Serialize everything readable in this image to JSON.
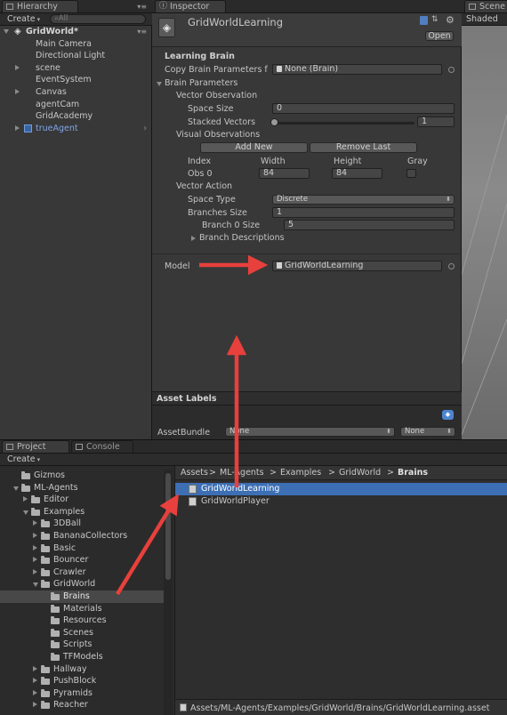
{
  "hierarchy": {
    "tab_label": "Hierarchy",
    "create_label": "Create",
    "search_placeholder": "All",
    "scene_name": "GridWorld*",
    "items": [
      {
        "label": "Main Camera",
        "expandable": false
      },
      {
        "label": "Directional Light",
        "expandable": false
      },
      {
        "label": "scene",
        "expandable": true
      },
      {
        "label": "EventSystem",
        "expandable": false
      },
      {
        "label": "Canvas",
        "expandable": true
      },
      {
        "label": "agentCam",
        "expandable": false
      },
      {
        "label": "GridAcademy",
        "expandable": false
      },
      {
        "label": "trueAgent",
        "expandable": true
      }
    ]
  },
  "inspector": {
    "tab_label": "Inspector",
    "object_name": "GridWorldLearning",
    "open_label": "Open",
    "section_title": "Learning Brain",
    "copy_brain_label": "Copy Brain Parameters f",
    "copy_brain_value": "None (Brain)",
    "brain_params_label": "Brain Parameters",
    "vector_observation_label": "Vector Observation",
    "space_size_label": "Space Size",
    "space_size_value": "0",
    "stacked_vectors_label": "Stacked Vectors",
    "stacked_vectors_value": "1",
    "visual_observations_label": "Visual Observations",
    "add_new_label": "Add New",
    "remove_last_label": "Remove Last",
    "col_index": "Index",
    "col_width": "Width",
    "col_height": "Height",
    "col_gray": "Gray",
    "obs0_label": "Obs 0",
    "obs0_width": "84",
    "obs0_height": "84",
    "vector_action_label": "Vector Action",
    "space_type_label": "Space Type",
    "space_type_value": "Discrete",
    "branches_size_label": "Branches Size",
    "branches_size_value": "1",
    "branch0_size_label": "Branch 0 Size",
    "branch0_size_value": "5",
    "branch_descriptions_label": "Branch Descriptions",
    "model_label": "Model",
    "model_value": "GridWorldLearning",
    "asset_labels_title": "Asset Labels",
    "assetbundle_label": "AssetBundle",
    "assetbundle_value": "None",
    "assetbundle_variant": "None"
  },
  "scene": {
    "tab_label": "Scene",
    "shaded_label": "Shaded"
  },
  "project": {
    "tab_label": "Project",
    "console_tab_label": "Console",
    "create_label": "Create",
    "tree": [
      {
        "label": "Gizmos",
        "indent": 1,
        "toggle": "none"
      },
      {
        "label": "ML-Agents",
        "indent": 1,
        "toggle": "down"
      },
      {
        "label": "Editor",
        "indent": 2,
        "toggle": "right"
      },
      {
        "label": "Examples",
        "indent": 2,
        "toggle": "down"
      },
      {
        "label": "3DBall",
        "indent": 3,
        "toggle": "right"
      },
      {
        "label": "BananaCollectors",
        "indent": 3,
        "toggle": "right"
      },
      {
        "label": "Basic",
        "indent": 3,
        "toggle": "right"
      },
      {
        "label": "Bouncer",
        "indent": 3,
        "toggle": "right"
      },
      {
        "label": "Crawler",
        "indent": 3,
        "toggle": "right"
      },
      {
        "label": "GridWorld",
        "indent": 3,
        "toggle": "down"
      },
      {
        "label": "Brains",
        "indent": 4,
        "toggle": "none",
        "selected": true
      },
      {
        "label": "Materials",
        "indent": 4,
        "toggle": "none"
      },
      {
        "label": "Resources",
        "indent": 4,
        "toggle": "none"
      },
      {
        "label": "Scenes",
        "indent": 4,
        "toggle": "none"
      },
      {
        "label": "Scripts",
        "indent": 4,
        "toggle": "none"
      },
      {
        "label": "TFModels",
        "indent": 4,
        "toggle": "none"
      },
      {
        "label": "Hallway",
        "indent": 3,
        "toggle": "right"
      },
      {
        "label": "PushBlock",
        "indent": 3,
        "toggle": "right"
      },
      {
        "label": "Pyramids",
        "indent": 3,
        "toggle": "right"
      },
      {
        "label": "Reacher",
        "indent": 3,
        "toggle": "right"
      }
    ],
    "breadcrumb": [
      {
        "label": "Assets",
        "bold": false
      },
      {
        "label": "ML-Agents",
        "bold": false
      },
      {
        "label": "Examples",
        "bold": false
      },
      {
        "label": "GridWorld",
        "bold": false
      },
      {
        "label": "Brains",
        "bold": true
      }
    ],
    "breadcrumb_separator": ">",
    "assets": [
      {
        "label": "GridWorldLearning",
        "selected": true
      },
      {
        "label": "GridWorldPlayer",
        "selected": false
      }
    ],
    "status_path": "Assets/ML-Agents/Examples/GridWorld/Brains/GridWorldLearning.asset"
  },
  "colors": {
    "arrow_red": "#e8403c",
    "selection_blue": "#3d6fb5",
    "panel_bg": "#383838",
    "dark_bg": "#2b2b2b"
  }
}
